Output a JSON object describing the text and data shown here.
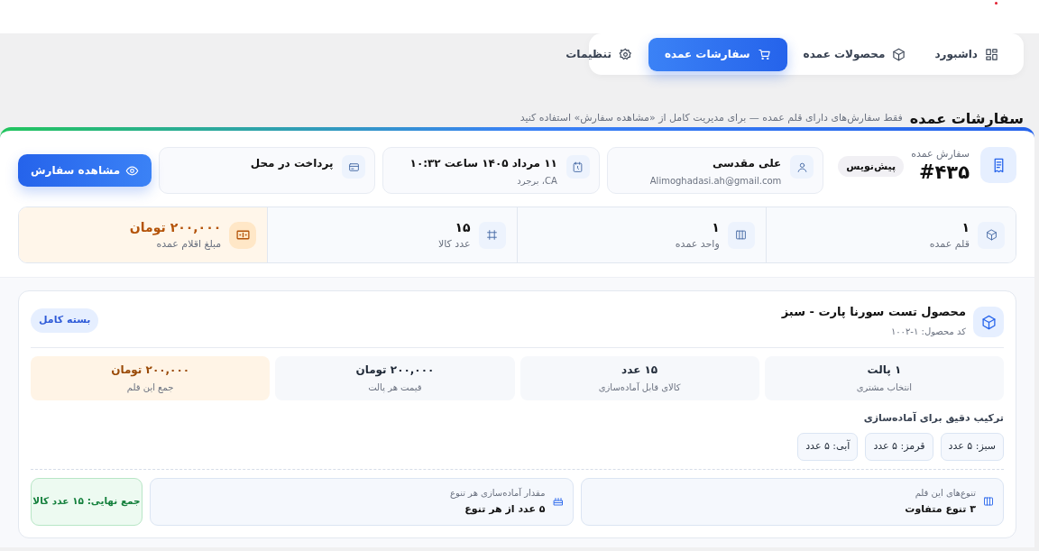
{
  "nav": {
    "tabs": [
      {
        "kind": "dashboard",
        "label": "داشبورد",
        "selected": false
      },
      {
        "kind": "products",
        "label": "محصولات عمده",
        "selected": false
      },
      {
        "kind": "orders",
        "label": "سفارشات عمده",
        "selected": true
      },
      {
        "kind": "settings",
        "label": "تنظیمات",
        "selected": false
      }
    ]
  },
  "header": {
    "title": "سفارشات عمده",
    "subtitle": "فقط سفارش‌های دارای قلم عمده — برای مدیریت کامل از «مشاهده سفارش» استفاده کنید"
  },
  "order": {
    "label": "سفارش عمده",
    "number": "#۴۳۵",
    "status": "پیش‌نویس",
    "info": [
      {
        "kind": "customer",
        "title": "علی مقدسی",
        "sub": "Alimoghadasi.ah@gmail.com"
      },
      {
        "kind": "date",
        "title": "۱۱ مرداد ۱۴۰۵ ساعت ۱۰:۳۲",
        "sub": "CA، برجرد"
      },
      {
        "kind": "payment",
        "title": "پرداخت در محل"
      }
    ],
    "view_button": "مشاهده سفارش"
  },
  "stats": [
    {
      "kind": "items",
      "value": "۱",
      "label": "قلم عمده",
      "highlight": false
    },
    {
      "kind": "units",
      "value": "۱",
      "label": "واحد عمده",
      "highlight": false
    },
    {
      "kind": "goods",
      "value": "۱۵",
      "label": "عدد کالا",
      "highlight": false
    },
    {
      "kind": "amount",
      "value": "۲۰۰,۰۰۰ تومان",
      "label": "مبلغ اقلام عمده",
      "highlight": true
    }
  ],
  "item": {
    "name": "محصول تست سورنا پارت - سبز",
    "code": "کد محصول: ۱-۱۰۰۲",
    "badge": "بسته کامل",
    "metrics": [
      {
        "value": "۱ پالت",
        "label": "انتخاب مشتری",
        "highlight": false
      },
      {
        "value": "۱۵ عدد",
        "label": "کالای قابل آماده‌سازی",
        "highlight": false
      },
      {
        "value": "۲۰۰,۰۰۰ تومان",
        "label": "قیمت هر پالت",
        "highlight": false
      },
      {
        "value": "۲۰۰,۰۰۰ تومان",
        "label": "جمع این قلم",
        "highlight": true
      }
    ],
    "composition_title": "ترکیب دقیق برای آماده‌سازی",
    "variants": [
      "سبز: ۵ عدد",
      "قرمز: ۵ عدد",
      "آبی: ۵ عدد"
    ],
    "summary": [
      {
        "kind": "variants",
        "label": "تنوع‌های این قلم",
        "value": "۳ تنوع متفاوت"
      },
      {
        "kind": "per_variant",
        "label": "مقدار آماده‌سازی هر تنوع",
        "value": "۵ عدد از هر تنوع"
      }
    ],
    "total": "جمع نهایی: ۱۵ عدد کالا"
  }
}
